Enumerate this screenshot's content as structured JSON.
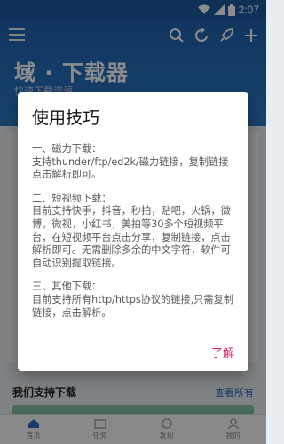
{
  "status": {
    "time": "2:07"
  },
  "app": {
    "title": "域 · 下载器",
    "subtitle": "快速下载资源"
  },
  "icons": [
    "menu-icon",
    "search-icon",
    "refresh-icon",
    "rocket-icon",
    "add-icon",
    "wifi-icon",
    "signal-icon",
    "battery-icon"
  ],
  "section": {
    "title": "我们支持下载",
    "see_all": "查看所有"
  },
  "nav": [
    {
      "label": "首页",
      "icon": "home-icon"
    },
    {
      "label": "任务",
      "icon": "folder-icon"
    },
    {
      "label": "发现",
      "icon": "explore-icon"
    },
    {
      "label": "我的",
      "icon": "user-icon"
    }
  ],
  "dialog": {
    "title": "使用技巧",
    "s1_head": "一、磁力下载：",
    "s1_body": "支持thunder/ftp/ed2k/磁力链接，复制链接点击解析即可。",
    "s2_head": "二、短视频下载：",
    "s2_body": "目前支持快手，抖音，秒拍，贴吧，火锅，微博，微视，小红书，美拍等30多个短视频平台，在短视频平台点击分享，复制链接，点击解析即可。无需删除多余的中文字符，软件可自动识别提取链接。",
    "s3_head": "三、其他下载：",
    "s3_body": "目前支持所有http/https协议的链接,只需复制链接，点击解析。",
    "action": "了解"
  },
  "colors": {
    "primary": "#1f62ad",
    "accent": "#d81b60"
  }
}
